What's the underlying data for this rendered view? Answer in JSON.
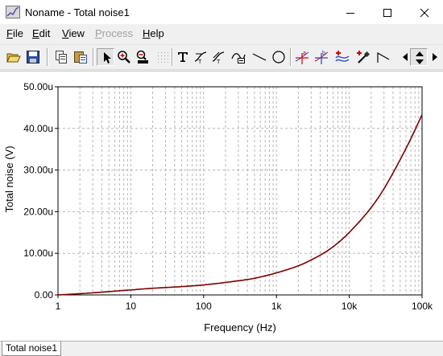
{
  "window": {
    "title": "Noname - Total noise1",
    "controls": [
      "minimize",
      "maximize",
      "close"
    ]
  },
  "menu": [
    {
      "label": "File",
      "accel": "F",
      "enabled": true
    },
    {
      "label": "Edit",
      "accel": "E",
      "enabled": true
    },
    {
      "label": "View",
      "accel": "V",
      "enabled": true
    },
    {
      "label": "Process",
      "accel": "P",
      "enabled": false
    },
    {
      "label": "Help",
      "accel": "H",
      "enabled": true
    }
  ],
  "toolbar": [
    {
      "icon": "open-folder-icon"
    },
    {
      "icon": "save-icon"
    },
    {
      "icon": "copy-icon"
    },
    {
      "icon": "paste-icon"
    },
    {
      "icon": "select-arrow-icon",
      "pressed": true
    },
    {
      "icon": "zoom-in-icon"
    },
    {
      "icon": "zoom-100-icon"
    },
    {
      "icon": "grid-icon",
      "disabled": true
    },
    {
      "icon": "text-icon"
    },
    {
      "icon": "curve-label-icon"
    },
    {
      "icon": "axis-label-icon"
    },
    {
      "icon": "legend-icon"
    },
    {
      "icon": "line-icon"
    },
    {
      "icon": "ellipse-icon"
    },
    {
      "icon": "cursor-a-icon"
    },
    {
      "icon": "cursor-b-icon"
    },
    {
      "icon": "add-curve-icon"
    },
    {
      "icon": "color-picker-icon"
    },
    {
      "icon": "step-icon"
    },
    {
      "icon": "arrow-left-icon"
    },
    {
      "icon": "arrow-up-down-icon"
    },
    {
      "icon": "arrow-right-icon"
    }
  ],
  "colors": {
    "curve": "#7a0000",
    "grid": "#b4b4b4",
    "axis": "#000000"
  },
  "chart_data": {
    "type": "line",
    "title": "",
    "xlabel": "Frequency (Hz)",
    "ylabel": "Total noise (V)",
    "xscale": "log",
    "xlim": [
      1,
      100000
    ],
    "ylim": [
      0,
      50
    ],
    "y_unit_suffix": "u",
    "x_tick_labels": [
      "1",
      "10",
      "100",
      "1k",
      "10k",
      "100k"
    ],
    "y_tick_labels": [
      "0.00",
      "10.00u",
      "20.00u",
      "30.00u",
      "40.00u",
      "50.00u"
    ],
    "grid": "on",
    "series": [
      {
        "x": [
          1,
          2,
          5,
          10,
          20,
          50,
          100,
          200,
          500,
          1000,
          2000,
          3000,
          5000,
          7000,
          10000,
          20000,
          30000,
          50000,
          70000,
          100000
        ],
        "y": [
          0.0,
          0.3,
          0.8,
          1.2,
          1.6,
          2.0,
          2.4,
          3.0,
          4.0,
          5.3,
          7.0,
          8.4,
          10.6,
          12.5,
          15.0,
          21.0,
          25.5,
          32.5,
          37.5,
          43.3
        ]
      }
    ]
  },
  "tabs": [
    {
      "label": "Total noise1",
      "active": true
    }
  ]
}
